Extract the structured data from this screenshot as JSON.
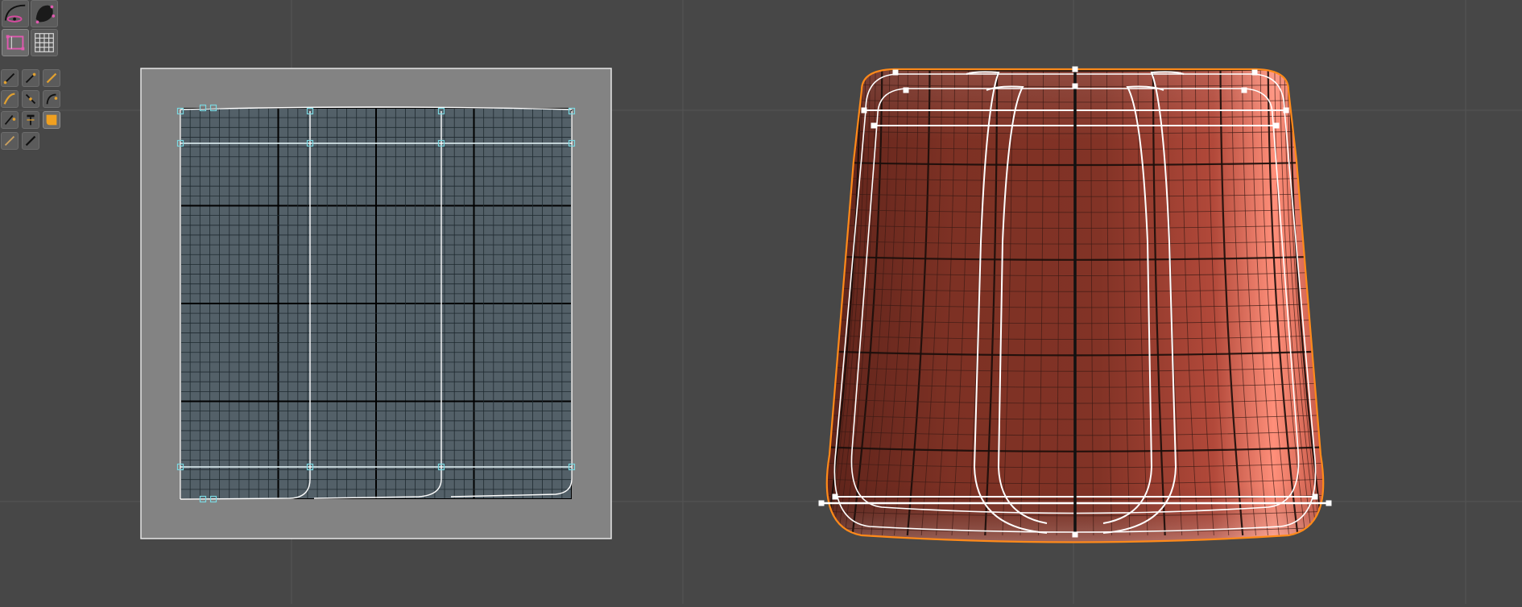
{
  "viewport": {
    "background": "#474747",
    "grid_color": "#545454"
  },
  "toolbar": {
    "tools": [
      {
        "name": "curve-draw-tool-icon",
        "group": "top"
      },
      {
        "name": "surface-sculpt-tool-icon",
        "group": "top"
      },
      {
        "name": "uv-frame-tool-icon",
        "group": "top"
      },
      {
        "name": "grid-tool-icon",
        "group": "top"
      },
      {
        "name": "pen-tool-icon",
        "group": "small"
      },
      {
        "name": "pen-plus-tool-icon",
        "group": "small"
      },
      {
        "name": "brush-tool-icon",
        "group": "small"
      },
      {
        "name": "blend-brush-tool-icon",
        "group": "small"
      },
      {
        "name": "line-tool-icon",
        "group": "small"
      },
      {
        "name": "curve-pen-tool-icon",
        "group": "small"
      },
      {
        "name": "smooth-pen-tool-icon",
        "group": "small"
      },
      {
        "name": "pin-tool-icon",
        "group": "small"
      },
      {
        "name": "fill-tool-icon",
        "group": "small"
      },
      {
        "name": "pencil-tool-icon",
        "group": "small"
      },
      {
        "name": "knife-tool-icon",
        "group": "small"
      }
    ]
  },
  "uv_panel": {
    "frame_color": "#838383",
    "border_color": "#e6e6e6",
    "square_color": "#536068",
    "handle_color": "#7ad7e0",
    "minor_line_color": "#1f2a30",
    "major_line_color": "#000000"
  },
  "shape": {
    "color_main": "#8c3b2c",
    "color_dark": "#5f241b",
    "color_highlight": "#ff8f7a",
    "outline_color": "#ff8a1a",
    "curve_color": "#ffffff"
  }
}
